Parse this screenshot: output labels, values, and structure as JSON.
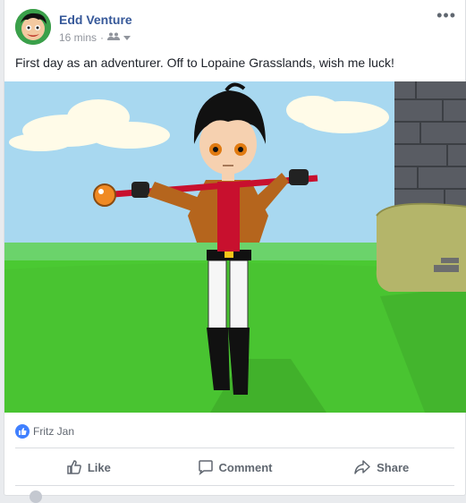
{
  "post": {
    "author": "Edd Venture",
    "timestamp": "16 mins",
    "separator": "·",
    "audience_icon": "friends-icon",
    "message": "First day as an adventurer. Off to Lopaine Grasslands, wish me luck!"
  },
  "reactions": {
    "icon": "like-reaction-icon",
    "names": "Fritz Jan"
  },
  "actions": {
    "like_label": "Like",
    "comment_label": "Comment",
    "share_label": "Share"
  },
  "colors": {
    "author_link": "#365899",
    "like_blue": "#4080ff",
    "sky": "#a6d8f0",
    "grass": "#4cd137"
  }
}
